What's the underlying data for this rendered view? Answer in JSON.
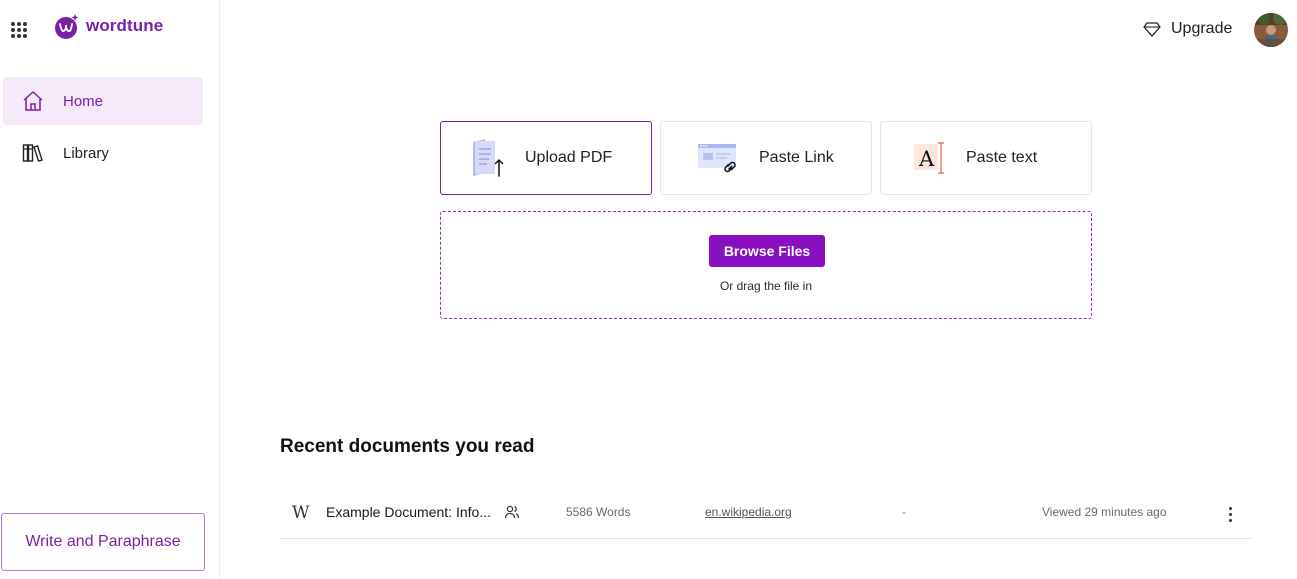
{
  "brand": {
    "name": "wordtune",
    "color": "#7a1fa8"
  },
  "sidebar": {
    "items": [
      {
        "label": "Home",
        "icon": "home-icon",
        "active": true
      },
      {
        "label": "Library",
        "icon": "library-icon",
        "active": false
      }
    ],
    "write_button": "Write and Paraphrase"
  },
  "header": {
    "upgrade_label": "Upgrade",
    "upgrade_icon": "diamond-icon",
    "avatar": "user-avatar"
  },
  "upload": {
    "options": [
      {
        "label": "Upload PDF",
        "icon": "pdf-upload-icon",
        "selected": true
      },
      {
        "label": "Paste Link",
        "icon": "paste-link-icon",
        "selected": false
      },
      {
        "label": "Paste text",
        "icon": "paste-text-icon",
        "selected": false
      }
    ],
    "browse_button": "Browse Files",
    "drag_hint": "Or drag the file in",
    "accent_color": "#8a0fbf"
  },
  "recent": {
    "title": "Recent documents you read",
    "documents": [
      {
        "source_glyph": "W",
        "title": "Example Document: Info...",
        "words": "5586 Words",
        "source": "en.wikipedia.org",
        "extra": "-",
        "viewed": "Viewed 29 minutes ago"
      }
    ]
  }
}
